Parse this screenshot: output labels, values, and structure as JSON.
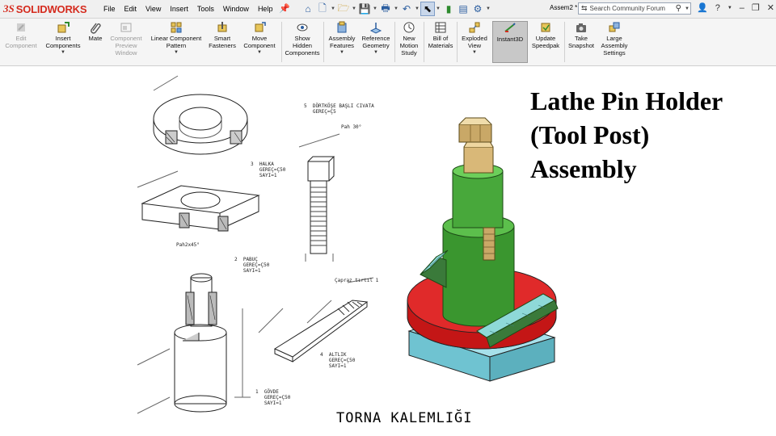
{
  "app": {
    "logo_prefix": "3S",
    "logo_name": "SOLIDWORKS"
  },
  "menu": [
    "File",
    "Edit",
    "View",
    "Insert",
    "Tools",
    "Window",
    "Help"
  ],
  "quick_icons": [
    "home-icon",
    "new-document-icon",
    "open-icon",
    "save-icon",
    "print-icon",
    "undo-icon",
    "select-icon",
    "rebuild-icon",
    "file-properties-icon",
    "options-icon"
  ],
  "document": {
    "name": "Assem2 *"
  },
  "search": {
    "placeholder": "Search Community Forum"
  },
  "toolbar": [
    {
      "label": "Edit\nComponent",
      "disabled": true
    },
    {
      "label": "Insert\nComponents",
      "disabled": false
    },
    {
      "label": "Mate",
      "disabled": false
    },
    {
      "label": "Component\nPreview\nWindow",
      "disabled": true
    },
    {
      "label": "Linear Component\nPattern",
      "disabled": false
    },
    {
      "label": "Smart\nFasteners",
      "disabled": false
    },
    {
      "label": "Move\nComponent",
      "disabled": false
    },
    {
      "label": "Show\nHidden\nComponents",
      "disabled": false
    },
    {
      "label": "Assembly\nFeatures",
      "disabled": false
    },
    {
      "label": "Reference\nGeometry",
      "disabled": false
    },
    {
      "label": "New\nMotion\nStudy",
      "disabled": false
    },
    {
      "label": "Bill of\nMaterials",
      "disabled": false
    },
    {
      "label": "Exploded\nView",
      "disabled": false
    },
    {
      "label": "Instant3D",
      "disabled": false,
      "active": true
    },
    {
      "label": "Update\nSpeedpak",
      "disabled": false
    },
    {
      "label": "Take\nSnapshot",
      "disabled": false
    },
    {
      "label": "Large\nAssembly\nSettings",
      "disabled": false
    }
  ],
  "canvas": {
    "title_lines": [
      "Lathe Pin Holder",
      "(Tool Post)",
      "Assembly"
    ],
    "caption": "TORNA KALEMLIĞI",
    "drawing_labels": {
      "part3": "3  HALKA\n   GEREÇ=Ç50\n   SAYI=1",
      "part2": "2  PABUÇ\n   GEREÇ=Ç50\n   SAYI=1",
      "part5": "5  DÖRTKÖŞE BAŞLI CIVATA\n   GEREÇ=Ç5",
      "part4": "4  ALTLIK\n   GEREÇ=Ç50\n   SAYI=1",
      "part1": "1  GÖVDE\n   GEREÇ=Ç50\n   SAYI=1",
      "pah1": "Pah 30°",
      "pah2": "Pah2x45°",
      "capraz": "Çapraz tırtıl 1"
    }
  },
  "colors": {
    "brand_red": "#d52b1e",
    "model_green": "#3f9a37",
    "model_red": "#d81f1f",
    "model_cyan": "#7fcfdc",
    "bolt_tan": "#d9b878"
  }
}
